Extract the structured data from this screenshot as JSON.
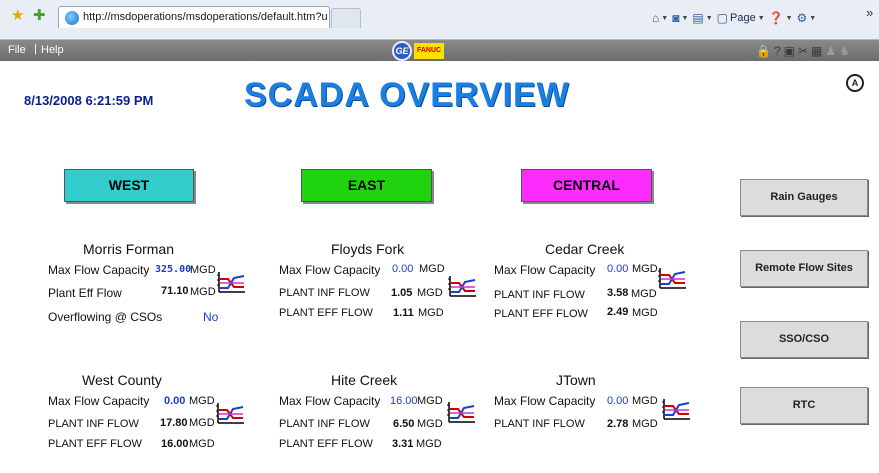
{
  "browser": {
    "tab_title": "http://msdoperations/msdoperations/default.htm?use...",
    "commands": {
      "page_label": "Page",
      "chevron": "»"
    }
  },
  "app_menu": {
    "file_label": "File",
    "separator": "|",
    "help_label": "Help",
    "ge_logo_text": "GE",
    "fanuc_logo_text": "FANUC"
  },
  "header": {
    "timestamp": "8/13/2008  6:21:59 PM",
    "title": "SCADA OVERVIEW",
    "alarm_icon_text": "A"
  },
  "regions": {
    "west": "WEST",
    "east": "EAST",
    "central": "CENTRAL"
  },
  "nav": {
    "rain": "Rain Gauges",
    "remote": "Remote Flow Sites",
    "sso": "SSO/CSO",
    "rtc": "RTC"
  },
  "stations": {
    "morris_forman": {
      "name": "Morris Forman",
      "row1_label": "Max Flow Capacity",
      "row1_value": "325.00",
      "row1_unit": "MGD",
      "row2_label": "Plant Eff Flow",
      "row2_value": "71.10",
      "row2_unit": "MGD",
      "row3_label": "Overflowing @ CSOs",
      "row3_value": "No"
    },
    "floyds_fork": {
      "name": "Floyds Fork",
      "row1_label": "Max Flow Capacity",
      "row1_value": "0.00",
      "row1_unit": "MGD",
      "row2_label": "PLANT INF FLOW",
      "row2_value": "1.05",
      "row2_unit": "MGD",
      "row3_label": "PLANT EFF FLOW",
      "row3_value": "1.11",
      "row3_unit": "MGD"
    },
    "cedar_creek": {
      "name": "Cedar Creek",
      "row1_label": "Max Flow Capacity",
      "row1_value": "0.00",
      "row1_unit": "MGD",
      "row2_label": "PLANT INF FLOW",
      "row2_value": "3.58",
      "row2_unit": "MGD",
      "row3_label": "PLANT EFF FLOW",
      "row3_value": "2.49",
      "row3_unit": "MGD"
    },
    "west_county": {
      "name": "West County",
      "row1_label": "Max Flow Capacity",
      "row1_value": "0.00",
      "row1_unit": "MGD",
      "row2_label": "PLANT INF FLOW",
      "row2_value": "17.80",
      "row2_unit": "MGD",
      "row3_label": "PLANT EFF FLOW",
      "row3_value": "16.00",
      "row3_unit": "MGD"
    },
    "hite_creek": {
      "name": "Hite Creek",
      "row1_label": "Max Flow Capacity",
      "row1_value": "16.00",
      "row1_unit": "MGD",
      "row2_label": "PLANT INF FLOW",
      "row2_value": "6.50",
      "row2_unit": "MGD",
      "row3_label": "PLANT EFF FLOW",
      "row3_value": "3.31",
      "row3_unit": "MGD"
    },
    "jtown": {
      "name": "JTown",
      "row1_label": "Max Flow Capacity",
      "row1_value": "0.00",
      "row1_unit": "MGD",
      "row2_label": "PLANT INF FLOW",
      "row2_value": "2.78",
      "row2_unit": "MGD"
    }
  },
  "icons": {
    "favorites": "star-icon",
    "add_favorites": "add-favorite-icon",
    "trend": "trend-chart-icon"
  },
  "colors": {
    "west": "#33cccc",
    "east": "#1fd40f",
    "central": "#ff2cff",
    "title": "#1a7fe0",
    "timestamp": "#0a1f8f",
    "value_blue": "#1a3ccf"
  }
}
